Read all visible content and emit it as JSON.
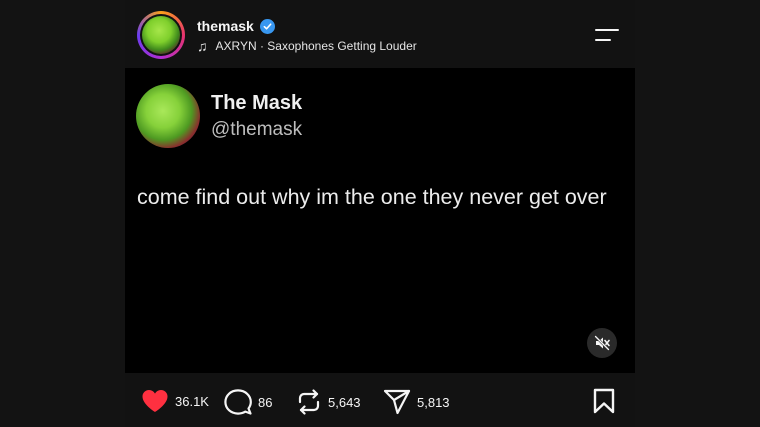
{
  "header": {
    "username": "themask",
    "music": "AXRYN · Saxophones Getting Louder"
  },
  "post": {
    "display_name": "The Mask",
    "handle": "@themask",
    "text": "come find out why im the one they never get over"
  },
  "actions": {
    "likes": "36.1K",
    "comments": "86",
    "reposts": "5,643",
    "shares": "5,813"
  },
  "colors": {
    "like_red": "#ff3040",
    "verified_blue": "#3897f0",
    "background": "#000000"
  },
  "icons": [
    "verified-badge-icon",
    "music-note-icon",
    "menu-icon",
    "mute-icon",
    "heart-icon",
    "comment-icon",
    "repost-icon",
    "share-icon",
    "bookmark-icon"
  ]
}
